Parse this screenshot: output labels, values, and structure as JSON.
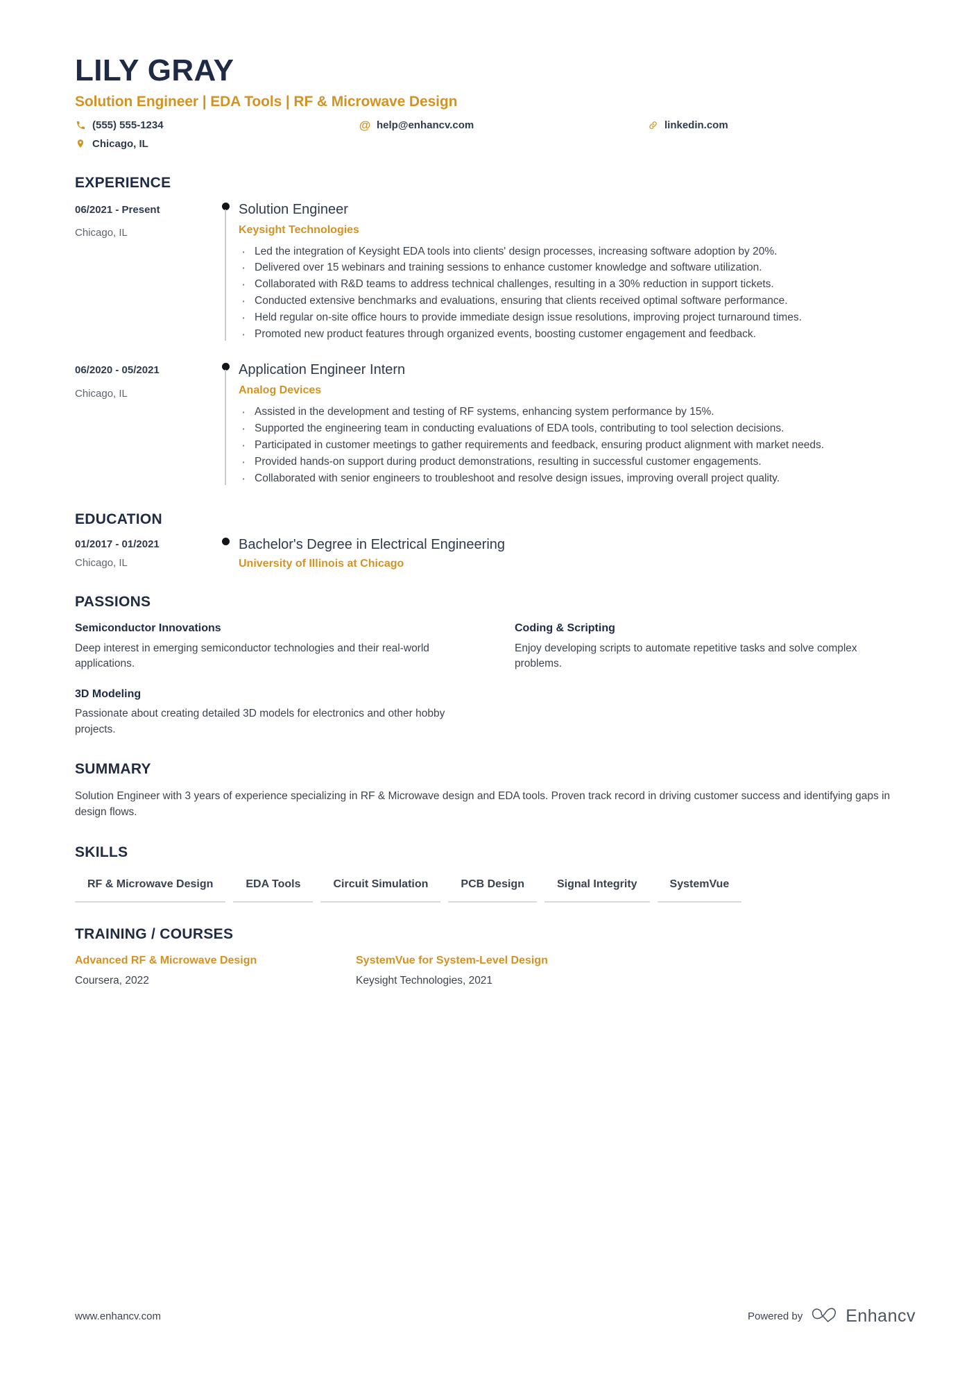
{
  "header": {
    "name": "LILY GRAY",
    "headline": "Solution Engineer | EDA Tools | RF & Microwave Design",
    "contacts": [
      {
        "icon": "phone-icon",
        "value": "(555) 555-1234"
      },
      {
        "icon": "email-icon",
        "value": "help@enhancv.com"
      },
      {
        "icon": "link-icon",
        "value": "linkedin.com"
      },
      {
        "icon": "location-pin-icon",
        "value": "Chicago, IL"
      }
    ]
  },
  "experience": {
    "title": "EXPERIENCE",
    "entries": [
      {
        "date": "06/2021 - Present",
        "location": "Chicago, IL",
        "role": "Solution Engineer",
        "company": "Keysight Technologies",
        "bullets": [
          "Led the integration of Keysight EDA tools into clients' design processes, increasing software adoption by 20%.",
          "Delivered over 15 webinars and training sessions to enhance customer knowledge and software utilization.",
          "Collaborated with R&D teams to address technical challenges, resulting in a 30% reduction in support tickets.",
          "Conducted extensive benchmarks and evaluations, ensuring that clients received optimal software performance.",
          "Held regular on-site office hours to provide immediate design issue resolutions, improving project turnaround times.",
          "Promoted new product features through organized events, boosting customer engagement and feedback."
        ]
      },
      {
        "date": "06/2020 - 05/2021",
        "location": "Chicago, IL",
        "role": "Application Engineer Intern",
        "company": "Analog Devices",
        "bullets": [
          "Assisted in the development and testing of RF systems, enhancing system performance by 15%.",
          "Supported the engineering team in conducting evaluations of EDA tools, contributing to tool selection decisions.",
          "Participated in customer meetings to gather requirements and feedback, ensuring product alignment with market needs.",
          "Provided hands-on support during product demonstrations, resulting in successful customer engagements.",
          "Collaborated with senior engineers to troubleshoot and resolve design issues, improving overall project quality."
        ]
      }
    ]
  },
  "education": {
    "title": "EDUCATION",
    "entries": [
      {
        "date": "01/2017 - 01/2021",
        "location": "Chicago, IL",
        "degree": "Bachelor's Degree in Electrical Engineering",
        "school": "University of Illinois at Chicago"
      }
    ]
  },
  "passions": {
    "title": "PASSIONS",
    "items": [
      {
        "name": "Semiconductor Innovations",
        "description": "Deep interest in emerging semiconductor technologies and their real-world applications."
      },
      {
        "name": "Coding & Scripting",
        "description": "Enjoy developing scripts to automate repetitive tasks and solve complex problems."
      },
      {
        "name": "3D Modeling",
        "description": "Passionate about creating detailed 3D models for electronics and other hobby projects."
      }
    ]
  },
  "summary": {
    "title": "SUMMARY",
    "text": "Solution Engineer with 3 years of experience specializing in RF & Microwave design and EDA tools. Proven track record in driving customer success and identifying gaps in design flows."
  },
  "skills": {
    "title": "SKILLS",
    "items": [
      "RF & Microwave Design",
      "EDA Tools",
      "Circuit Simulation",
      "PCB Design",
      "Signal Integrity",
      "SystemVue"
    ]
  },
  "training": {
    "title": "TRAINING / COURSES",
    "items": [
      {
        "name": "Advanced RF & Microwave Design",
        "provider": "Coursera, 2022"
      },
      {
        "name": "SystemVue for System-Level Design",
        "provider": "Keysight Technologies, 2021"
      }
    ]
  },
  "footer": {
    "url": "www.enhancv.com",
    "powered_by": "Powered by",
    "brand": "Enhancv"
  },
  "colors": {
    "accent_gold": "#d39324",
    "heading_navy": "#1f2a44",
    "body_gray": "#3c4350"
  }
}
